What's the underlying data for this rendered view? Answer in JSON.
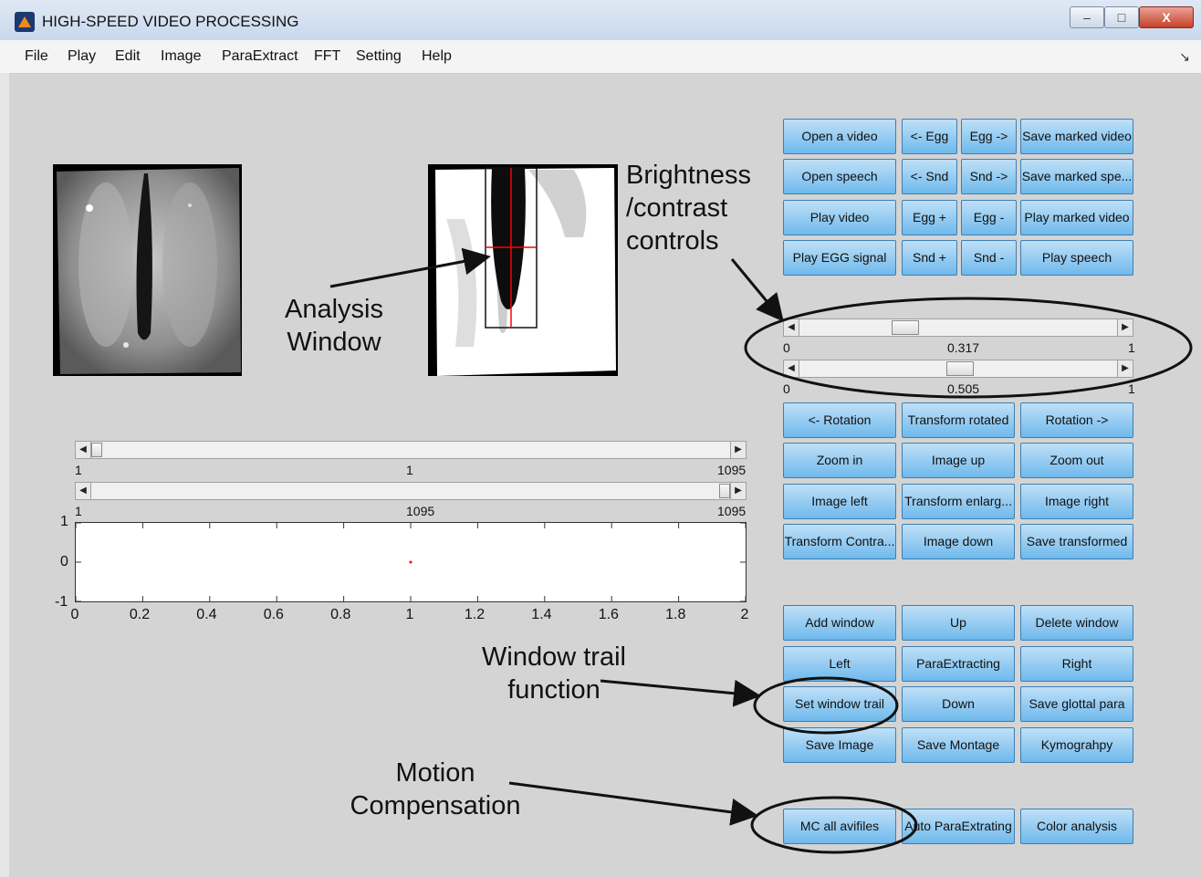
{
  "window": {
    "title": "HIGH-SPEED VIDEO PROCESSING",
    "min": "–",
    "max": "□",
    "close": "X"
  },
  "menu": [
    "File",
    "Play",
    "Edit",
    "Image",
    "ParaExtract",
    "FFT",
    "Setting",
    "Help"
  ],
  "menu_pin": "↘",
  "top_buttons": [
    [
      "Open a video",
      "<- Egg",
      "Egg ->",
      "Save marked video"
    ],
    [
      "Open speech",
      "<- Snd",
      "Snd ->",
      "Save marked spe..."
    ],
    [
      "Play video",
      "Egg +",
      "Egg -",
      "Play marked video"
    ],
    [
      "Play EGG signal",
      "Snd +",
      "Snd -",
      "Play speech"
    ]
  ],
  "brightness_slider": {
    "min": "0",
    "max": "1",
    "value": "0.317",
    "fraction": 0.317
  },
  "contrast_slider": {
    "min": "0",
    "max": "1",
    "value": "0.505",
    "fraction": 0.505
  },
  "transform_buttons": [
    [
      "<- Rotation",
      "Transform rotated",
      "Rotation ->"
    ],
    [
      "Zoom in",
      "Image up",
      "Zoom out"
    ],
    [
      "Image left",
      "Transform enlarg...",
      "Image right"
    ],
    [
      "Transform Contra...",
      "Image down",
      "Save transformed"
    ]
  ],
  "window_buttons": [
    [
      "Add window",
      "Up",
      "Delete window"
    ],
    [
      "Left",
      "ParaExtracting",
      "Right"
    ],
    [
      "Set window trail",
      "Down",
      "Save glottal para"
    ],
    [
      "Save Image",
      "Save Montage",
      "Kymograhpy"
    ]
  ],
  "bottom_buttons": [
    "MC all avifiles",
    "Auto ParaExtrating",
    "Color analysis"
  ],
  "frame_slider_1": {
    "min": "1",
    "max": "1095",
    "value": "1",
    "fraction": 0.0
  },
  "frame_slider_2": {
    "min": "1",
    "max": "1095",
    "value": "1095",
    "fraction": 1.0
  },
  "plot": {
    "y_ticks": [
      "1",
      "0",
      "-1"
    ],
    "x_ticks": [
      "0",
      "0.2",
      "0.4",
      "0.6",
      "0.8",
      "1",
      "1.2",
      "1.4",
      "1.6",
      "1.8",
      "2"
    ],
    "marker_x": 1.0,
    "marker_color": "#ff0000"
  },
  "annotations": {
    "analysis_window": [
      "Analysis",
      "Window"
    ],
    "brightness": [
      "Brightness",
      "/contrast",
      "controls"
    ],
    "window_trail": [
      "Window trail",
      "function"
    ],
    "motion": [
      "Motion",
      "Compensation"
    ]
  },
  "colors": {
    "button_top": "#bfe0f7",
    "button_bottom": "#6fb9ec",
    "background": "#d4d4d4",
    "crosshair": "#ff0000"
  }
}
